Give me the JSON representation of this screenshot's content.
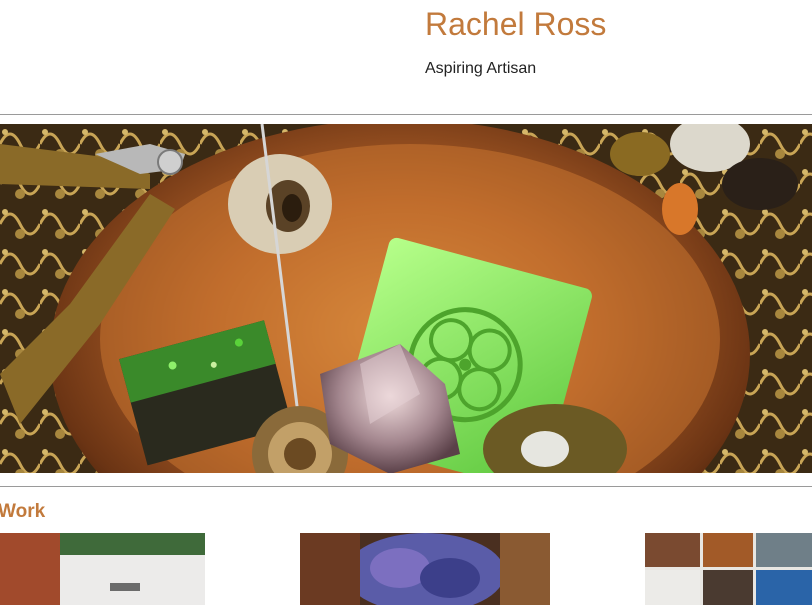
{
  "header": {
    "site_title": "Rachel Ross",
    "tagline": "Aspiring Artisan"
  },
  "hero": {
    "image_name": "jewelry-beads-copper-bowl-photo"
  },
  "work": {
    "heading": "Work",
    "thumbnails": [
      {
        "image_name": "work-thumbnail-1"
      },
      {
        "image_name": "work-thumbnail-2"
      },
      {
        "image_name": "work-thumbnail-3"
      }
    ]
  },
  "colors": {
    "accent": "#c27a3c",
    "text": "#222222",
    "rule": "#9a9a9a"
  }
}
